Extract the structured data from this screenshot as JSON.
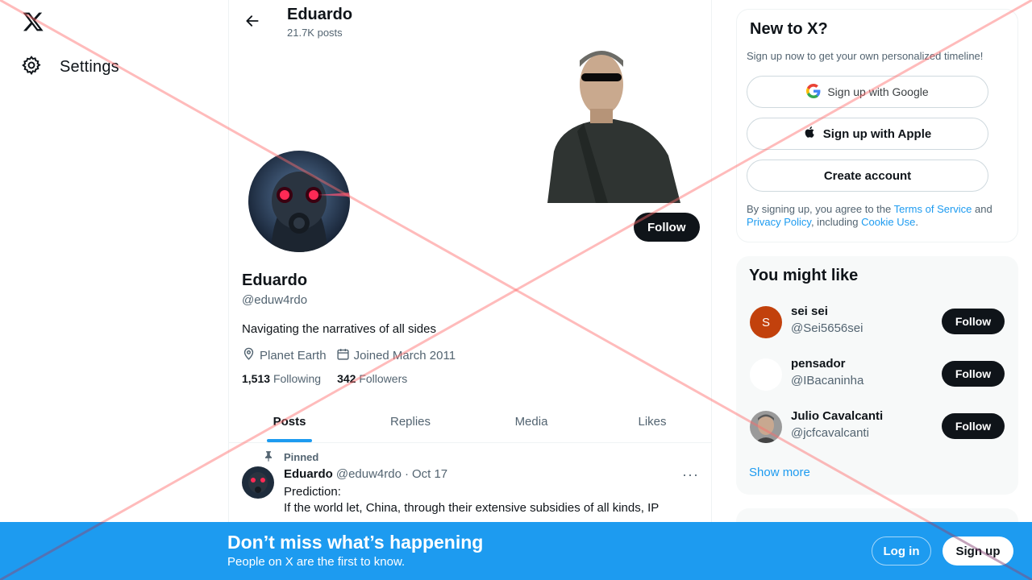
{
  "nav": {
    "settings_label": "Settings"
  },
  "header": {
    "name": "Eduardo",
    "post_count": "21.7K posts"
  },
  "profile": {
    "follow_label": "Follow",
    "name": "Eduardo",
    "handle": "@eduw4rdo",
    "bio": "Navigating the narratives of all sides",
    "location": "Planet Earth",
    "joined": "Joined March 2011",
    "following_count": "1,513",
    "following_label": "Following",
    "followers_count": "342",
    "followers_label": "Followers"
  },
  "tabs": [
    {
      "label": "Posts"
    },
    {
      "label": "Replies"
    },
    {
      "label": "Media"
    },
    {
      "label": "Likes"
    }
  ],
  "post": {
    "pinned_label": "Pinned",
    "author": "Eduardo",
    "handle": "@eduw4rdo",
    "separator": "·",
    "date": "Oct 17",
    "line1": "Prediction:",
    "line2": "If the world let, China, through their extensive subsidies of all kinds, IP"
  },
  "signup_card": {
    "title": "New to X?",
    "subtitle": "Sign up now to get your own personalized timeline!",
    "google_label": "Sign up with Google",
    "apple_label": "Sign up with Apple",
    "create_label": "Create account",
    "terms_prefix": "By signing up, you agree to the ",
    "terms_link": "Terms of Service",
    "terms_and": " and ",
    "privacy_link": "Privacy Policy",
    "terms_including": ", including ",
    "cookie_link": "Cookie Use",
    "terms_end": "."
  },
  "suggestions": {
    "title": "You might like",
    "show_more": "Show more",
    "users": [
      {
        "name": "sei sei",
        "handle": "@Sei5656sei",
        "initial": "S",
        "follow": "Follow",
        "avatar_color": "#c2410c"
      },
      {
        "name": "pensador",
        "handle": "@IBacaninha",
        "initial": "",
        "follow": "Follow",
        "avatar_color": "#ffffff"
      },
      {
        "name": "Julio Cavalcanti",
        "handle": "@jcfcavalcanti",
        "initial": "",
        "follow": "Follow",
        "avatar_color": "#8a8a8a"
      }
    ]
  },
  "bottom_bar": {
    "title": "Don’t miss what’s happening",
    "subtitle": "People on X are the first to know.",
    "login_label": "Log in",
    "signup_label": "Sign up"
  },
  "colors": {
    "accent": "#1d9bf0",
    "primary_button": "#0f1419",
    "overlay_x": "#ff6b6b"
  }
}
